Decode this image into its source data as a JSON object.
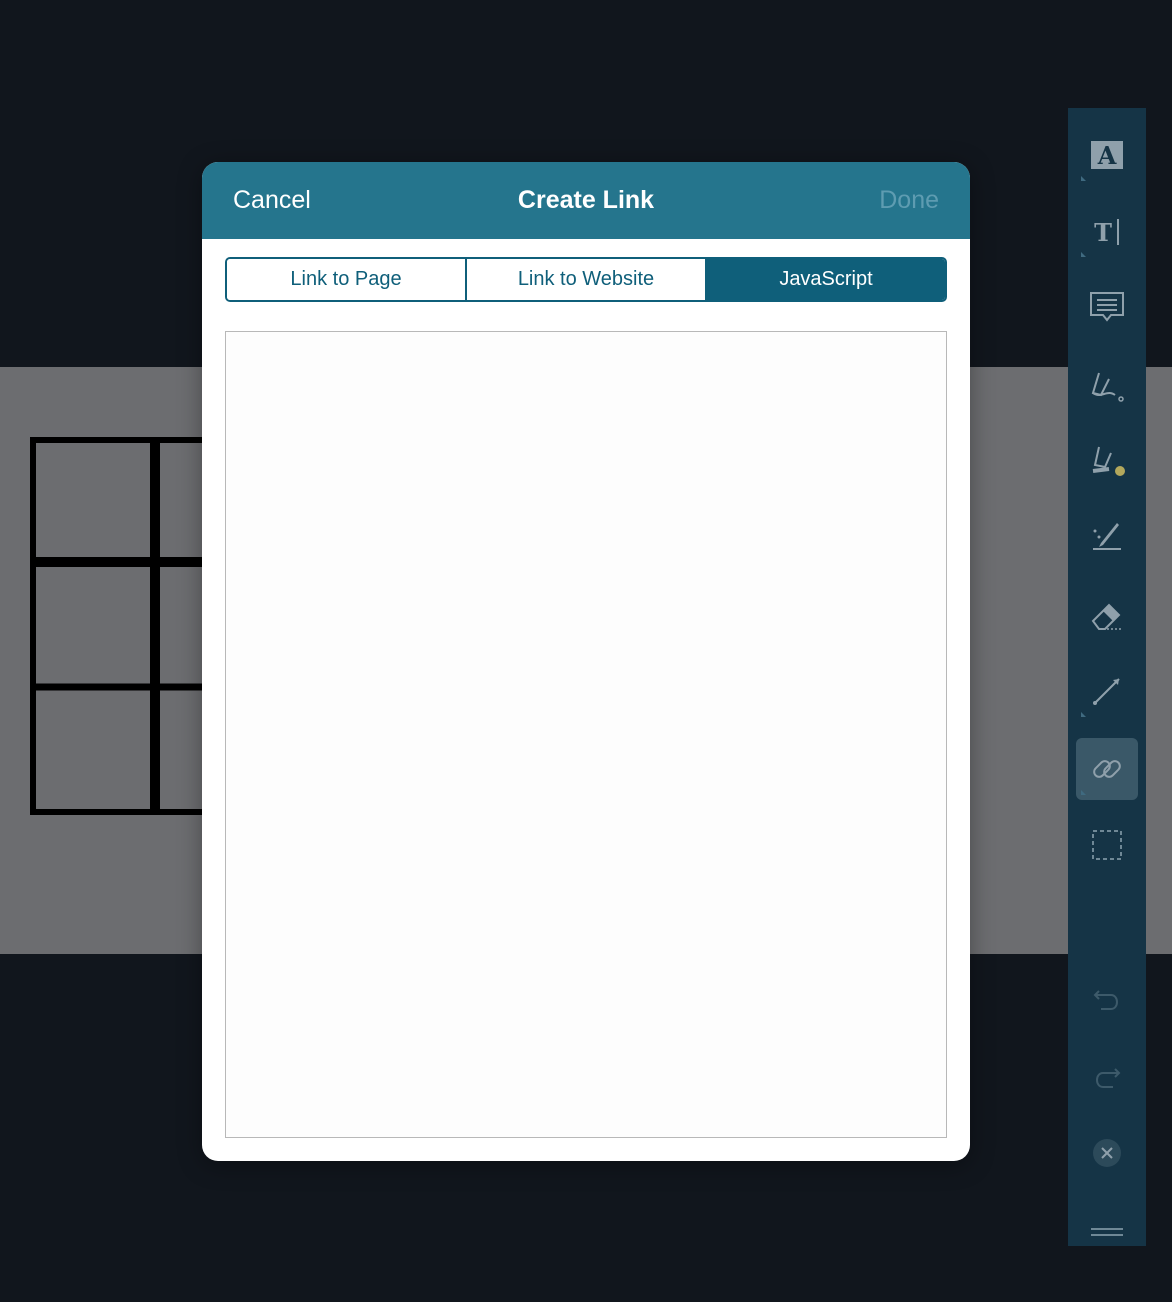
{
  "modal": {
    "cancel_label": "Cancel",
    "title": "Create Link",
    "done_label": "Done",
    "tabs": [
      {
        "label": "Link to Page",
        "selected": false
      },
      {
        "label": "Link to Website",
        "selected": false
      },
      {
        "label": "JavaScript",
        "selected": true
      }
    ],
    "script_value": ""
  },
  "toolbar": {
    "items": [
      {
        "icon": "text-box-icon",
        "active": false
      },
      {
        "icon": "typewriter-text-icon",
        "active": false
      },
      {
        "icon": "comment-icon",
        "active": false
      },
      {
        "icon": "pen-icon",
        "active": false
      },
      {
        "icon": "highlighter-icon",
        "active": false
      },
      {
        "icon": "smart-pen-icon",
        "active": false
      },
      {
        "icon": "eraser-icon",
        "active": false
      },
      {
        "icon": "line-arrow-icon",
        "active": false
      },
      {
        "icon": "link-icon",
        "active": true
      },
      {
        "icon": "selection-icon",
        "active": false
      },
      {
        "icon": "undo-icon",
        "active": false
      },
      {
        "icon": "redo-icon",
        "active": false
      },
      {
        "icon": "close-icon",
        "active": false
      },
      {
        "icon": "menu-icon",
        "active": false
      }
    ]
  },
  "colors": {
    "header": "#25758d",
    "accent": "#0f5f7a",
    "toolbar": "#153446",
    "background": "#11161d"
  }
}
